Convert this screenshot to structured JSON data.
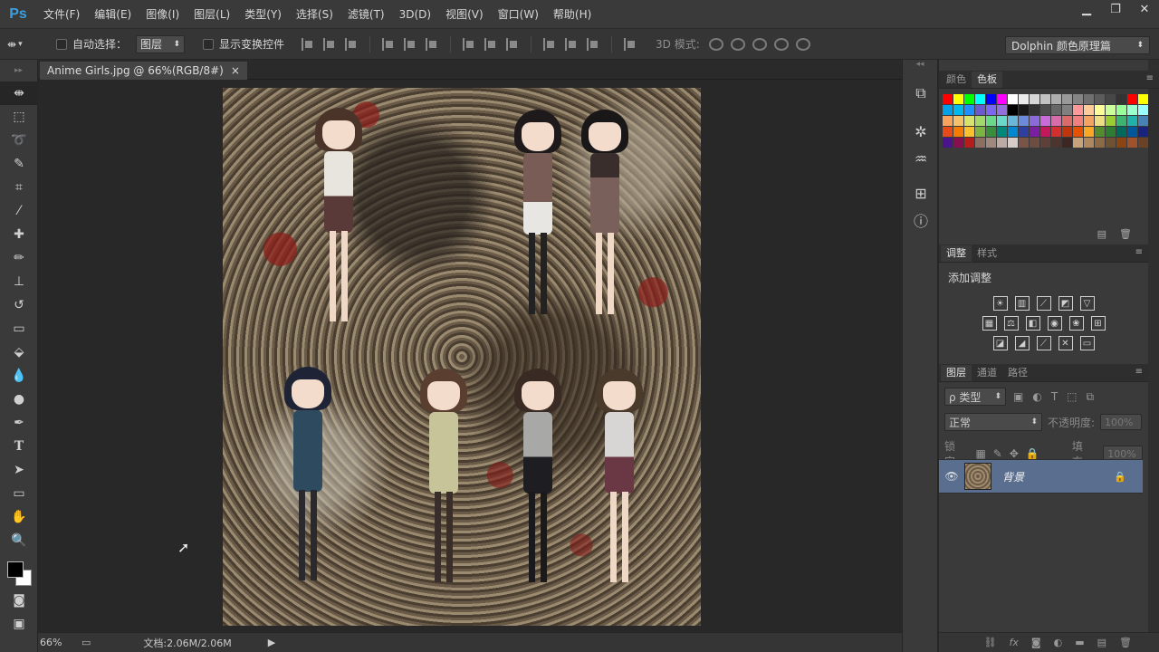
{
  "app": {
    "logo": "Ps"
  },
  "menu": [
    "文件(F)",
    "编辑(E)",
    "图像(I)",
    "图层(L)",
    "类型(Y)",
    "选择(S)",
    "滤镜(T)",
    "3D(D)",
    "视图(V)",
    "窗口(W)",
    "帮助(H)"
  ],
  "window_controls": {
    "minimize": "▁",
    "restore": "❐",
    "close": "✕"
  },
  "options": {
    "auto_select_label": "自动选择：",
    "auto_select_value": "图层",
    "show_transform_label": "显示变换控件",
    "mode3d_label": "3D 模式:",
    "workspace": "Dolphin 颜色原理篇"
  },
  "document": {
    "tab_title": "Anime Girls.jpg @ 66%(RGB/8#)",
    "close": "×"
  },
  "status": {
    "zoom": "66%",
    "doc_info": "文档:2.06M/2.06M",
    "arrow": "▶"
  },
  "panels": {
    "color_tabs": [
      "颜色",
      "色板"
    ],
    "adjust_tabs": [
      "调整",
      "样式"
    ],
    "adjust_title": "添加调整",
    "layers_tabs": [
      "图层",
      "通道",
      "路径"
    ],
    "kind_filter": "ρ 类型",
    "blend_mode": "正常",
    "opacity_label": "不透明度:",
    "opacity_value": "100%",
    "lock_label": "锁定:",
    "fill_label": "填充:",
    "fill_value": "100%",
    "layer_name": "背景"
  },
  "swatch_colors": [
    "#ff0000",
    "#ffff00",
    "#00ff00",
    "#00ffff",
    "#0000ff",
    "#ff00ff",
    "#ffffff",
    "#ebebeb",
    "#d6d6d6",
    "#c2c2c2",
    "#adadad",
    "#999999",
    "#858585",
    "#707070",
    "#5c5c5c",
    "#474747",
    "#333333",
    "#ff0000",
    "#ffff00",
    "#00a0e9",
    "#00b7ee",
    "#1e90ff",
    "#6a5acd",
    "#7b68ee",
    "#9370db",
    "#000000",
    "#1a1a1a",
    "#333333",
    "#4d4d4d",
    "#666666",
    "#808080",
    "#ff9999",
    "#ffcc99",
    "#ffff99",
    "#ccff99",
    "#99ff99",
    "#99ffcc",
    "#99ffff",
    "#f7a35c",
    "#f4c26b",
    "#d7e36b",
    "#a3d96b",
    "#6bd98a",
    "#6bd9c9",
    "#6bb7d9",
    "#6b8ad9",
    "#8a6bd9",
    "#c96bd9",
    "#d96baa",
    "#d96b6b",
    "#f08080",
    "#f4a460",
    "#eedd82",
    "#9acd32",
    "#3cb371",
    "#20b2aa",
    "#4682b4",
    "#e64a19",
    "#f57c00",
    "#fbc02d",
    "#7cb342",
    "#388e3c",
    "#00897b",
    "#0288d1",
    "#303f9f",
    "#7b1fa2",
    "#c2185b",
    "#d32f2f",
    "#bf360c",
    "#e65100",
    "#f9a825",
    "#558b2f",
    "#2e7d32",
    "#00695c",
    "#01579b",
    "#1a237e",
    "#4a148c",
    "#880e4f",
    "#b71c1c",
    "#8d6e63",
    "#a1887f",
    "#bcaaa4",
    "#d7ccc8",
    "#795548",
    "#6d4c41",
    "#5d4037",
    "#4e342e",
    "#3e2723",
    "#c8a27a",
    "#b08860",
    "#8b6a45",
    "#6e5233",
    "#8b4513",
    "#a0522d",
    "#6b4226"
  ]
}
